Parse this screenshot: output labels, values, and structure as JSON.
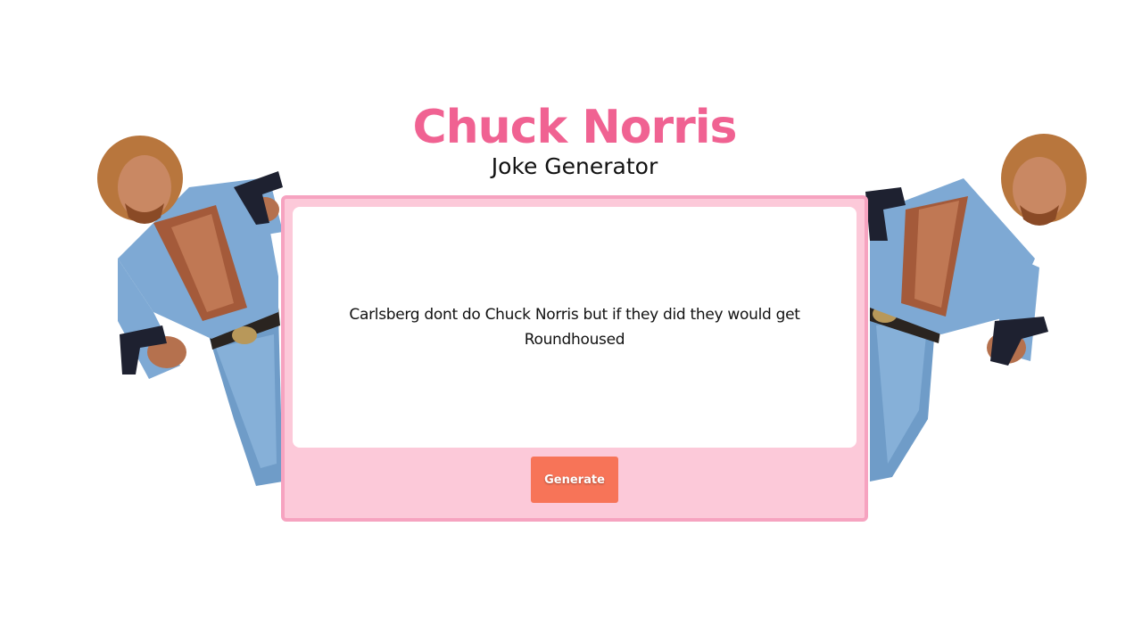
{
  "header": {
    "title": "Chuck Norris",
    "subtitle": "Joke Generator"
  },
  "joke": {
    "text": "Carlsberg dont do Chuck Norris but if they did they would get Roundhoused"
  },
  "actions": {
    "generate_label": "Generate"
  },
  "images": {
    "left": "chuck-norris-photo",
    "right": "chuck-norris-photo"
  },
  "colors": {
    "title": "#f06292",
    "card_background": "#fcc9d9",
    "card_border": "#f6a3c0",
    "button": "#f77458"
  }
}
